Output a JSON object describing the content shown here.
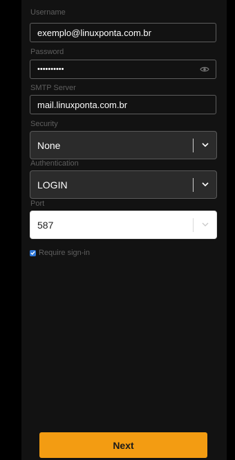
{
  "form": {
    "username": {
      "label": "Username",
      "value": "exemplo@linuxponta.com.br"
    },
    "password": {
      "label": "Password",
      "value": "••••••••••",
      "icon": "eye-icon"
    },
    "smtp_server": {
      "label": "SMTP Server",
      "value": "mail.linuxponta.com.br"
    },
    "security": {
      "label": "Security",
      "value": "None"
    },
    "authentication": {
      "label": "Authentication",
      "value": "LOGIN"
    },
    "port": {
      "label": "Port",
      "value": "587"
    },
    "require_signin": {
      "label": "Require sign-in",
      "checked": true
    }
  },
  "actions": {
    "next_label": "Next"
  },
  "colors": {
    "accent": "#f39c12",
    "checkbox": "#2f77d6",
    "background": "#121212"
  }
}
